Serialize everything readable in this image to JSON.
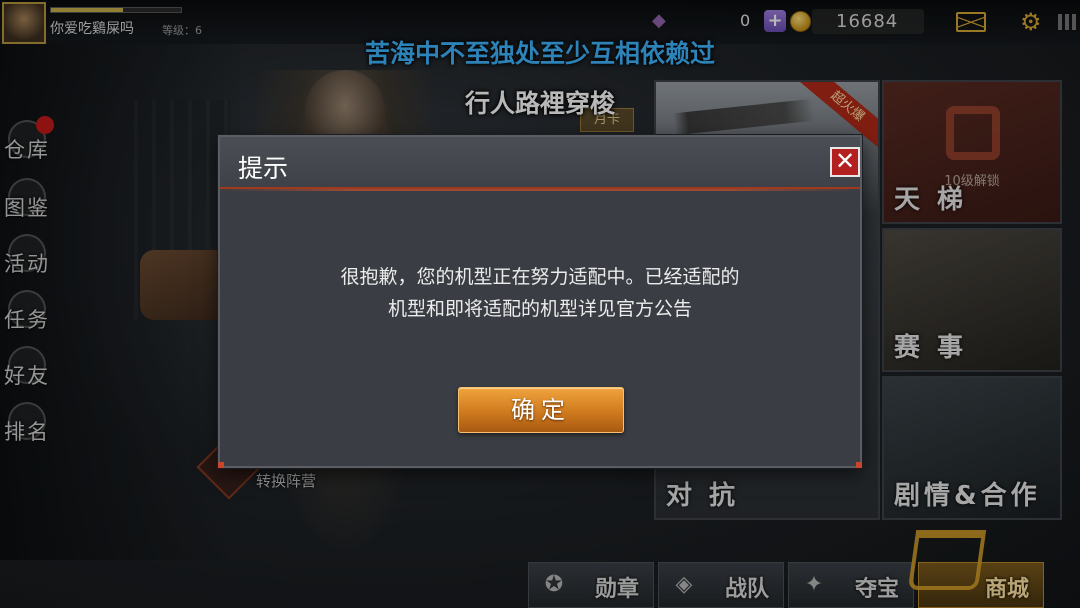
{
  "top_bar": {
    "player_name": "你爱吃鷄屎吗",
    "level_label": "等级：6",
    "xp_fraction": 0.55,
    "gem_count": "0",
    "coin_count": "16684"
  },
  "lyrics": {
    "line1": "苦海中不至独处至少互相依赖过",
    "line2": "行人路裡穿梭"
  },
  "side_menu": {
    "items": [
      {
        "label": "仓库"
      },
      {
        "label": "图鉴"
      },
      {
        "label": "活动"
      },
      {
        "label": "任务"
      },
      {
        "label": "好友"
      },
      {
        "label": "排名"
      }
    ]
  },
  "modes": {
    "versus": "对 抗",
    "ladder": "天 梯",
    "ladder_lock": "10级解锁",
    "event": "赛 事",
    "story": "剧情&合作",
    "hot_ribbon": "超火爆",
    "month_card": "月卡",
    "switch_camp": "转换阵营"
  },
  "bottom_tabs": [
    {
      "label": "勋章",
      "icon": "medal-icon"
    },
    {
      "label": "战队",
      "icon": "team-icon"
    },
    {
      "label": "夺宝",
      "icon": "treasure-icon"
    },
    {
      "label": "商城",
      "icon": "cart-icon"
    }
  ],
  "dialog": {
    "title": "提示",
    "message_line1": "很抱歉，您的机型正在努力适配中。已经适配的",
    "message_line2": "机型和即将适配的机型详见官方公告",
    "confirm_label": "确定",
    "close_glyph": "✕"
  },
  "colors": {
    "lyric_primary": "#3fb6ff",
    "confirm_button": "#cf7a1e",
    "close_button": "#b32020",
    "accent_gold": "#d7a731"
  }
}
